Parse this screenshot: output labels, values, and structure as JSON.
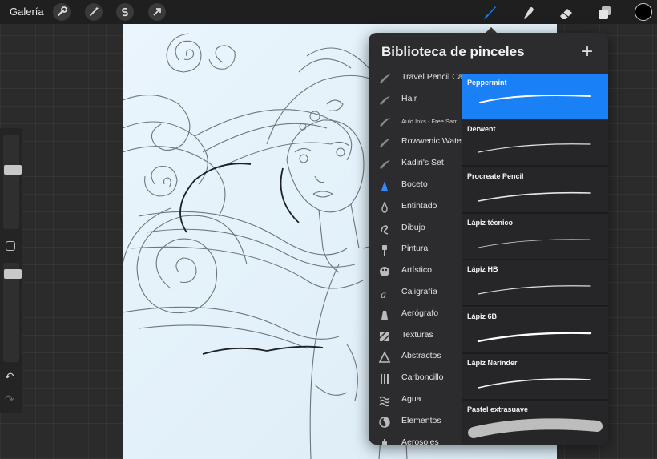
{
  "topbar": {
    "gallery_label": "Galería",
    "tools_left": [
      "wrench-icon",
      "magic-wand-icon",
      "selection-s-icon",
      "transform-arrow-icon"
    ],
    "tools_right": [
      "brush-icon",
      "smudge-icon",
      "eraser-icon",
      "layers-icon"
    ],
    "active_tool": "brush-icon",
    "active_color": "#000000"
  },
  "sidebar": {
    "brush_size_level": 0.16,
    "opacity_level": 0.16,
    "icons": [
      "modify-square-icon",
      "undo-icon",
      "redo-icon"
    ]
  },
  "brush_library": {
    "title": "Biblioteca de pinceles",
    "add_icon": "plus-icon",
    "sets": [
      {
        "label": "Travel Pencil Case",
        "icon": "stroke-icon"
      },
      {
        "label": "Hair",
        "icon": "stroke-icon"
      },
      {
        "label": "Auld Inks - Free Sam...",
        "icon": "stroke-icon"
      },
      {
        "label": "Rowwenic Watercolor",
        "icon": "stroke-icon"
      },
      {
        "label": "Kadiri's Set",
        "icon": "stroke-icon"
      },
      {
        "label": "Boceto",
        "icon": "pencil-tip-icon",
        "active": true
      },
      {
        "label": "Entintado",
        "icon": "ink-drop-icon"
      },
      {
        "label": "Dibujo",
        "icon": "squiggle-icon"
      },
      {
        "label": "Pintura",
        "icon": "paint-brush-icon"
      },
      {
        "label": "Artístico",
        "icon": "palette-icon"
      },
      {
        "label": "Caligrafía",
        "icon": "calligraphy-icon"
      },
      {
        "label": "Aerógrafo",
        "icon": "airbrush-icon"
      },
      {
        "label": "Texturas",
        "icon": "texture-icon"
      },
      {
        "label": "Abstractos",
        "icon": "triangle-icon"
      },
      {
        "label": "Carboncillo",
        "icon": "charcoal-icon"
      },
      {
        "label": "Agua",
        "icon": "waves-icon"
      },
      {
        "label": "Elementos",
        "icon": "yin-yang-icon"
      },
      {
        "label": "Aerosoles",
        "icon": "spray-can-icon"
      }
    ],
    "brushes": [
      {
        "name": "Peppermint",
        "selected": true
      },
      {
        "name": "Derwent"
      },
      {
        "name": "Procreate Pencil"
      },
      {
        "name": "Lápiz técnico"
      },
      {
        "name": "Lápiz HB"
      },
      {
        "name": "Lápiz 6B"
      },
      {
        "name": "Lápiz Narinder"
      },
      {
        "name": "Pastel extrasuave"
      }
    ]
  },
  "colors": {
    "accent": "#1a80f6",
    "panel_bg": "#2c2c2e",
    "canvas_bg": "#e6f3fb",
    "topbar_bg": "#1f1f1f"
  }
}
